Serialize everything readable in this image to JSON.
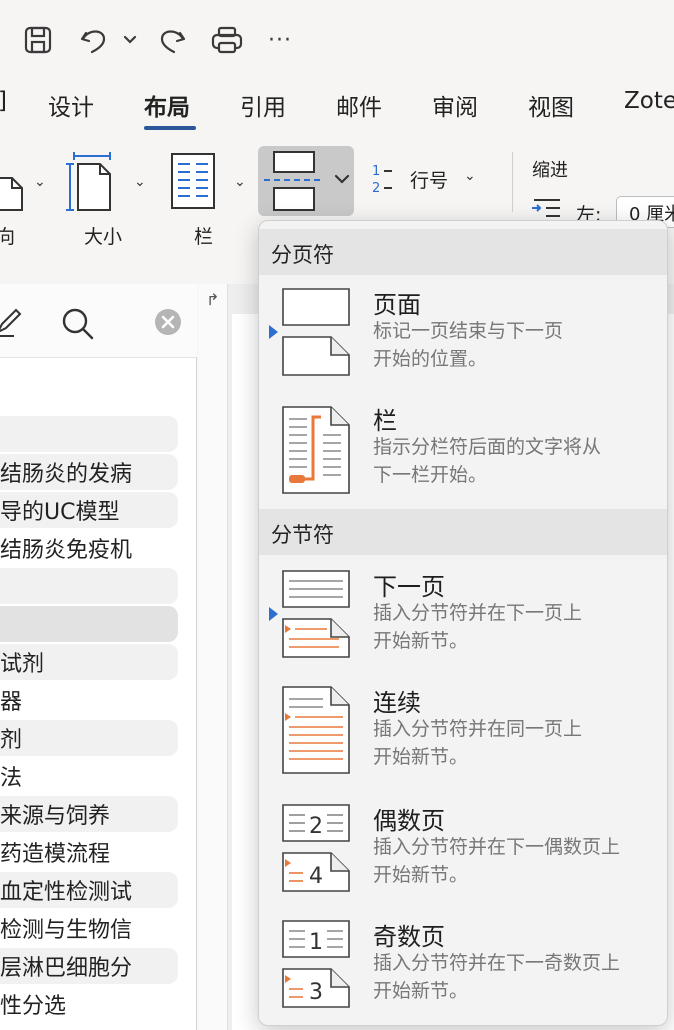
{
  "toolbar": {
    "icons": [
      "save-icon",
      "undo-icon",
      "undo-dropdown-icon",
      "redo-icon",
      "print-icon",
      "more-icon"
    ],
    "more_label": "···"
  },
  "tabs": {
    "partial_left": "]",
    "items": [
      "设计",
      "布局",
      "引用",
      "邮件",
      "审阅",
      "视图",
      "Zote"
    ],
    "active": "布局"
  },
  "ribbon": {
    "orientation_label": "向",
    "size_label": "大小",
    "columns_label": "栏",
    "line_numbers_label": "行号",
    "indent_title": "缩进",
    "indent_left_label": "左:",
    "indent_left_value": "0 厘米"
  },
  "nav": {
    "items": [
      "",
      "结肠炎的发病",
      "导的UC模型",
      "结肠炎免疫机",
      "",
      "",
      "试剂",
      "器",
      "剂",
      "法",
      "来源与饲养",
      "药造模流程",
      "血定性检测试",
      "检测与生物信",
      "层淋巴细胞分",
      "性分选"
    ]
  },
  "menu": {
    "section_page": "分页符",
    "section_section": "分节符",
    "items": [
      {
        "title": "页面",
        "desc1": "标记一页结束与下一页",
        "desc2": "开始的位置。"
      },
      {
        "title": "栏",
        "desc1": "指示分栏符后面的文字将从",
        "desc2": "下一栏开始。"
      },
      {
        "title": "下一页",
        "desc1": "插入分节符并在下一页上",
        "desc2": "开始新节。"
      },
      {
        "title": "连续",
        "desc1": "插入分节符并在同一页上",
        "desc2": "开始新节。"
      },
      {
        "title": "偶数页",
        "desc1": "插入分节符并在下一偶数页上",
        "desc2": "开始新节。",
        "num_top": "2",
        "num_bottom": "4"
      },
      {
        "title": "奇数页",
        "desc1": "插入分节符并在下一奇数页上",
        "desc2": "开始新节。",
        "num_top": "1",
        "num_bottom": "3"
      }
    ]
  },
  "colors": {
    "accent": "#2b579a",
    "orange": "#e8793a",
    "marker": "#2b6fd1"
  }
}
